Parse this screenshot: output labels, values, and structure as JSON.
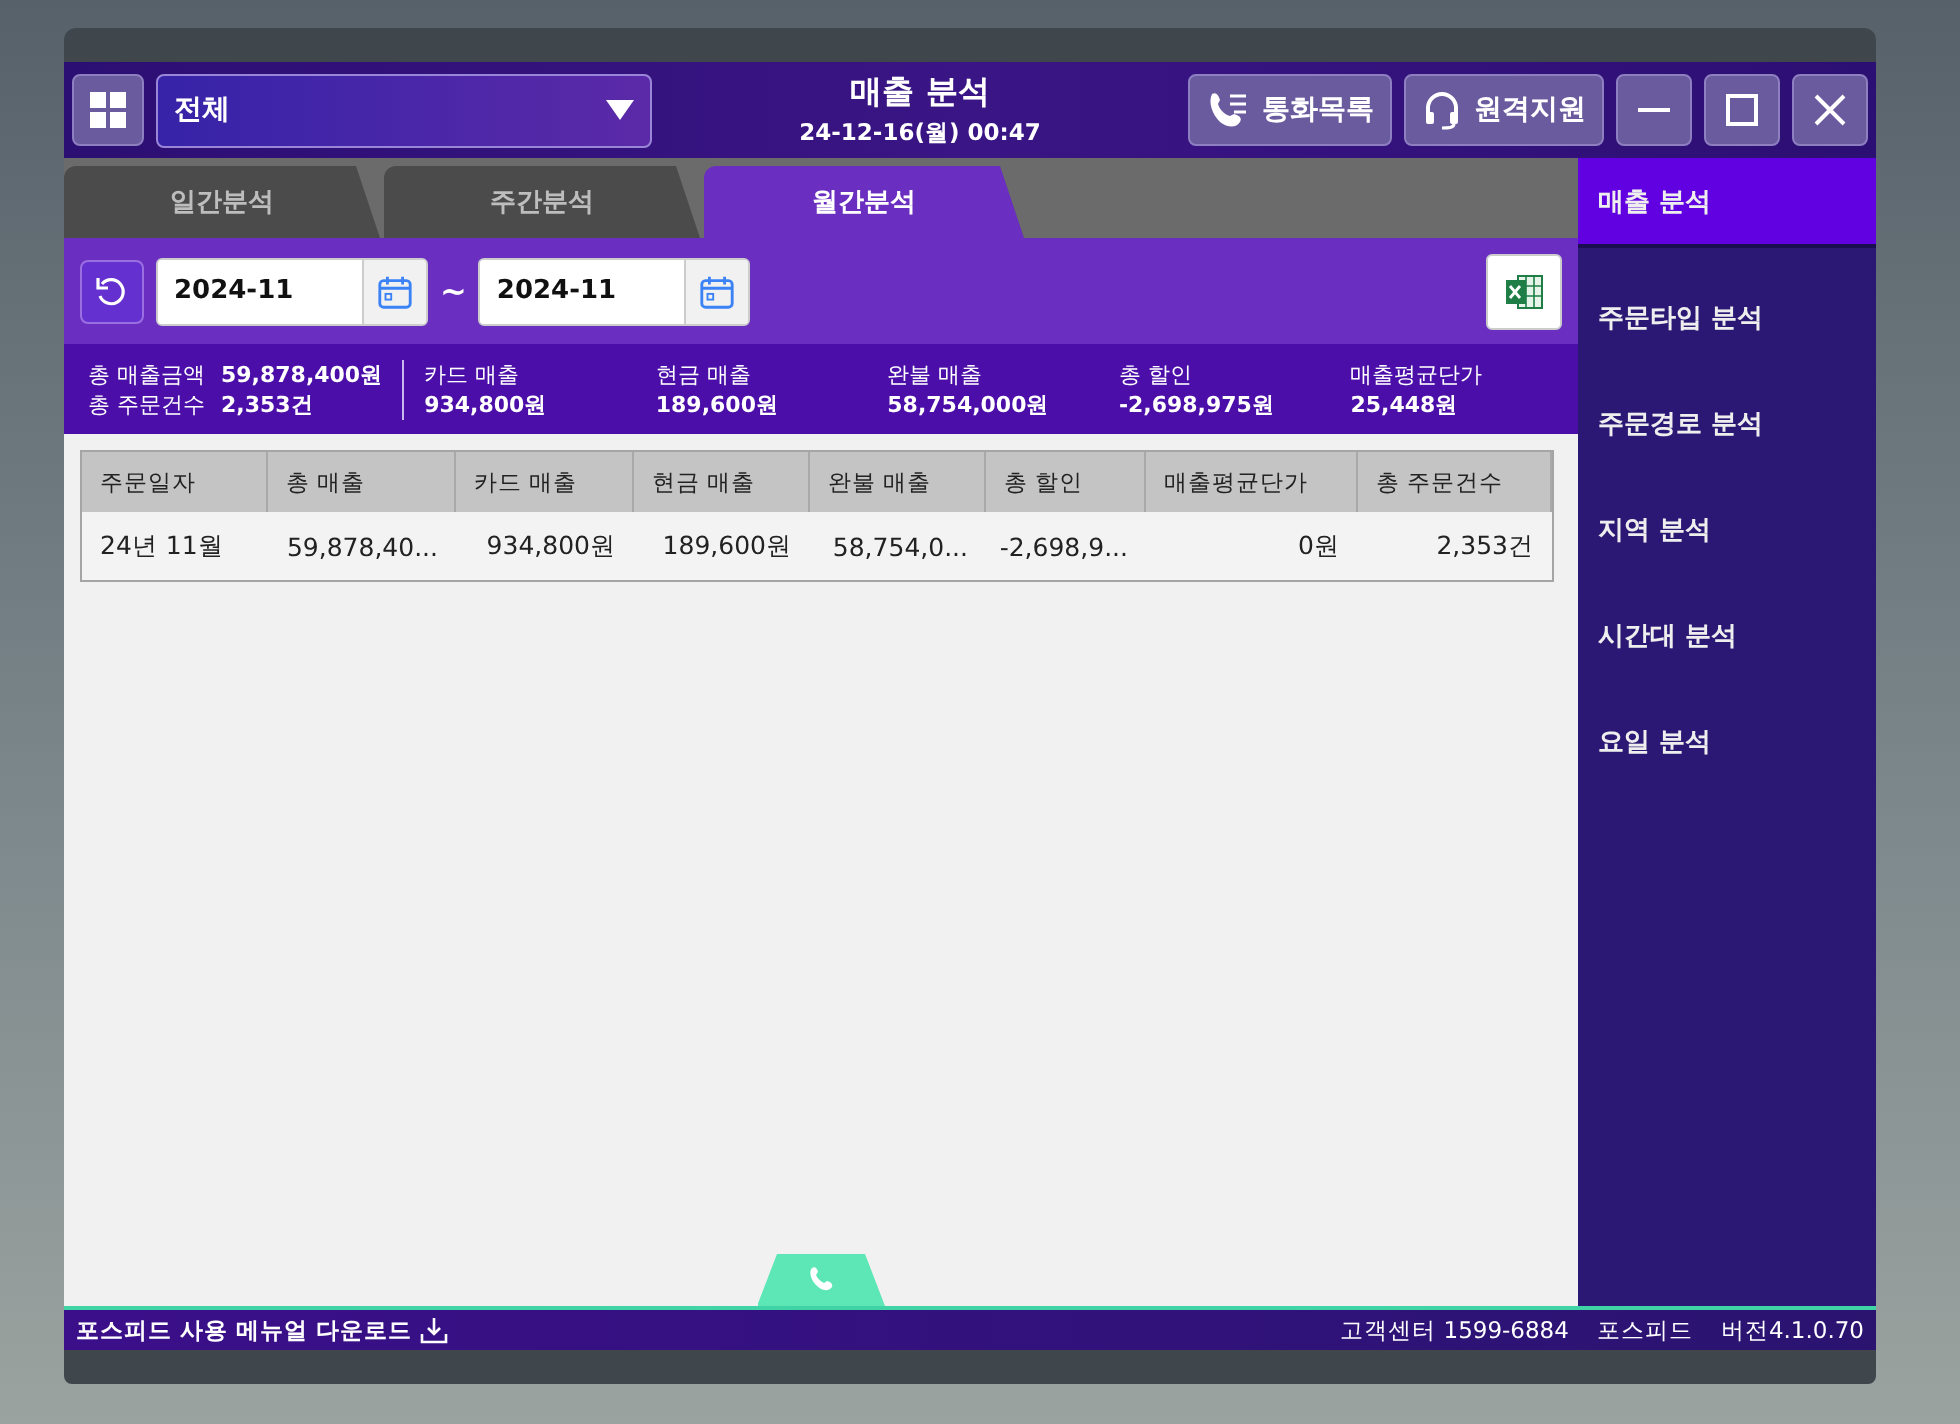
{
  "header": {
    "store_select": "전체",
    "title": "매출 분석",
    "datetime": "24-12-16(월) 00:47",
    "buttons": [
      {
        "kind": "call",
        "label": "통화목록"
      },
      {
        "kind": "support",
        "label": "원격지원"
      }
    ]
  },
  "tabs": [
    {
      "label": "일간분석",
      "selected": false
    },
    {
      "label": "주간분석",
      "selected": false
    },
    {
      "label": "월간분석",
      "selected": true
    }
  ],
  "date_range": {
    "from": "2024-11",
    "separator": "~",
    "to": "2024-11"
  },
  "summary": [
    {
      "label": "총 매출금액",
      "value": "59,878,400원",
      "label2": "총 주문건수",
      "value2": "2,353건"
    },
    {
      "label": "카드 매출",
      "value": "934,800원"
    },
    {
      "label": "현금 매출",
      "value": "189,600원"
    },
    {
      "label": "완불 매출",
      "value": "58,754,000원"
    },
    {
      "label": "총 할인",
      "value": "-2,698,975원"
    },
    {
      "label": "매출평균단가",
      "value": "25,448원"
    }
  ],
  "table": {
    "columns": [
      "주문일자",
      "총 매출",
      "카드 매출",
      "현금 매출",
      "완불 매출",
      "총 할인",
      "매출평균단가",
      "총 주문건수"
    ],
    "rows": [
      [
        "24년 11월",
        "59,878,40...",
        "934,800원",
        "189,600원",
        "58,754,0...",
        "-2,698,9...",
        "0원",
        "2,353건"
      ]
    ]
  },
  "sidebar": {
    "items": [
      {
        "label": "매출 분석",
        "selected": true
      },
      {
        "label": "주문타입 분석",
        "selected": false
      },
      {
        "label": "주문경로 분석",
        "selected": false
      },
      {
        "label": "지역 분석",
        "selected": false
      },
      {
        "label": "시간대 분석",
        "selected": false
      },
      {
        "label": "요일 분석",
        "selected": false
      }
    ]
  },
  "status_bar": {
    "manual_link": "포스피드 사용 메뉴얼 다운로드",
    "support": "고객센터 1599-6884",
    "brand": "포스피드",
    "version": "버전4.1.0.70"
  }
}
